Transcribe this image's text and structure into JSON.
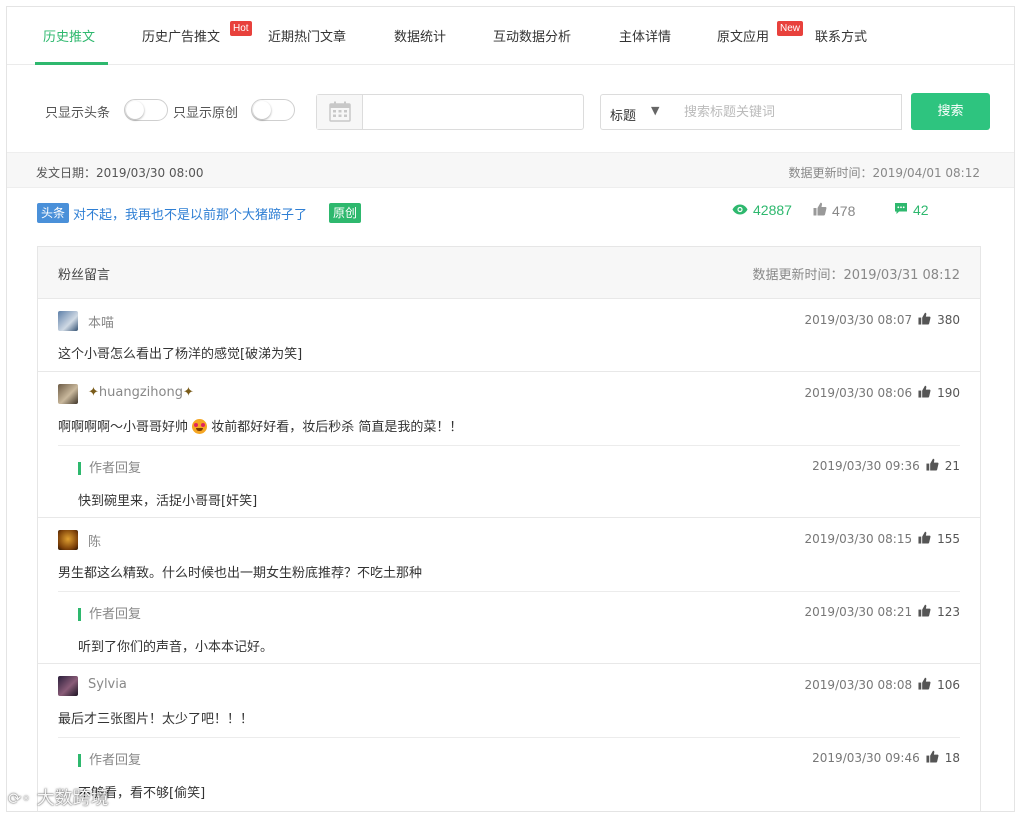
{
  "tabs": [
    {
      "label": "历史推文",
      "active": true
    },
    {
      "label": "历史广告推文",
      "badge": "Hot"
    },
    {
      "label": "近期热门文章"
    },
    {
      "label": "数据统计"
    },
    {
      "label": "互动数据分析"
    },
    {
      "label": "主体详情"
    },
    {
      "label": "原文应用",
      "badge": "New"
    },
    {
      "label": "联系方式"
    }
  ],
  "filters": {
    "only_headline_label": "只显示头条",
    "only_headline_on": false,
    "only_original_label": "只显示原创",
    "only_original_on": false,
    "date_value": "",
    "field_select": "标题",
    "search_placeholder": "搜索标题关键词",
    "search_button": "搜索"
  },
  "info": {
    "publish_date": "发文日期：2019/03/30 08:00",
    "data_updated": "数据更新时间：2019/04/01 08:12"
  },
  "article": {
    "headline_tag": "头条",
    "title": "对不起，我再也不是以前那个大猪蹄子了",
    "original_tag": "原创",
    "views": "42887",
    "likes": "478",
    "comments": "42"
  },
  "comments_panel": {
    "title": "粉丝留言",
    "updated": "数据更新时间：2019/03/31 08:12",
    "comments": [
      {
        "user": "本喵",
        "text": "这个小哥怎么看出了杨洋的感觉[破涕为笑]",
        "time": "2019/03/30 08:07",
        "likes": "380"
      },
      {
        "user": "huangzihong",
        "text_a": "啊啊啊啊～小哥哥好帅",
        "text_b": "妆前都好好看，妆后秒杀 简直是我的菜！！",
        "time": "2019/03/30 08:06",
        "likes": "190",
        "reply": {
          "label": "作者回复",
          "text": "快到碗里来，活捉小哥哥[奸笑]",
          "time": "2019/03/30 09:36",
          "likes": "21"
        }
      },
      {
        "user": "陈",
        "text": "男生都这么精致。什么时候也出一期女生粉底推荐？不吃土那种",
        "time": "2019/03/30 08:15",
        "likes": "155",
        "reply": {
          "label": "作者回复",
          "text": "听到了你们的声音，小本本记好。",
          "time": "2019/03/30 08:21",
          "likes": "123"
        }
      },
      {
        "user": "Sylvia",
        "text": "最后才三张图片！太少了吧！！！",
        "time": "2019/03/30 08:08",
        "likes": "106",
        "reply": {
          "label": "作者回复",
          "text": "不够看，看不够[偷笑]",
          "time": "2019/03/30 09:46",
          "likes": "18"
        }
      }
    ]
  },
  "watermark": "大数跨境",
  "colors": {
    "accent": "#2eb86e",
    "link": "#2f7fd4",
    "badge_red": "#e8413c",
    "headline_blue": "#4a90d9"
  }
}
